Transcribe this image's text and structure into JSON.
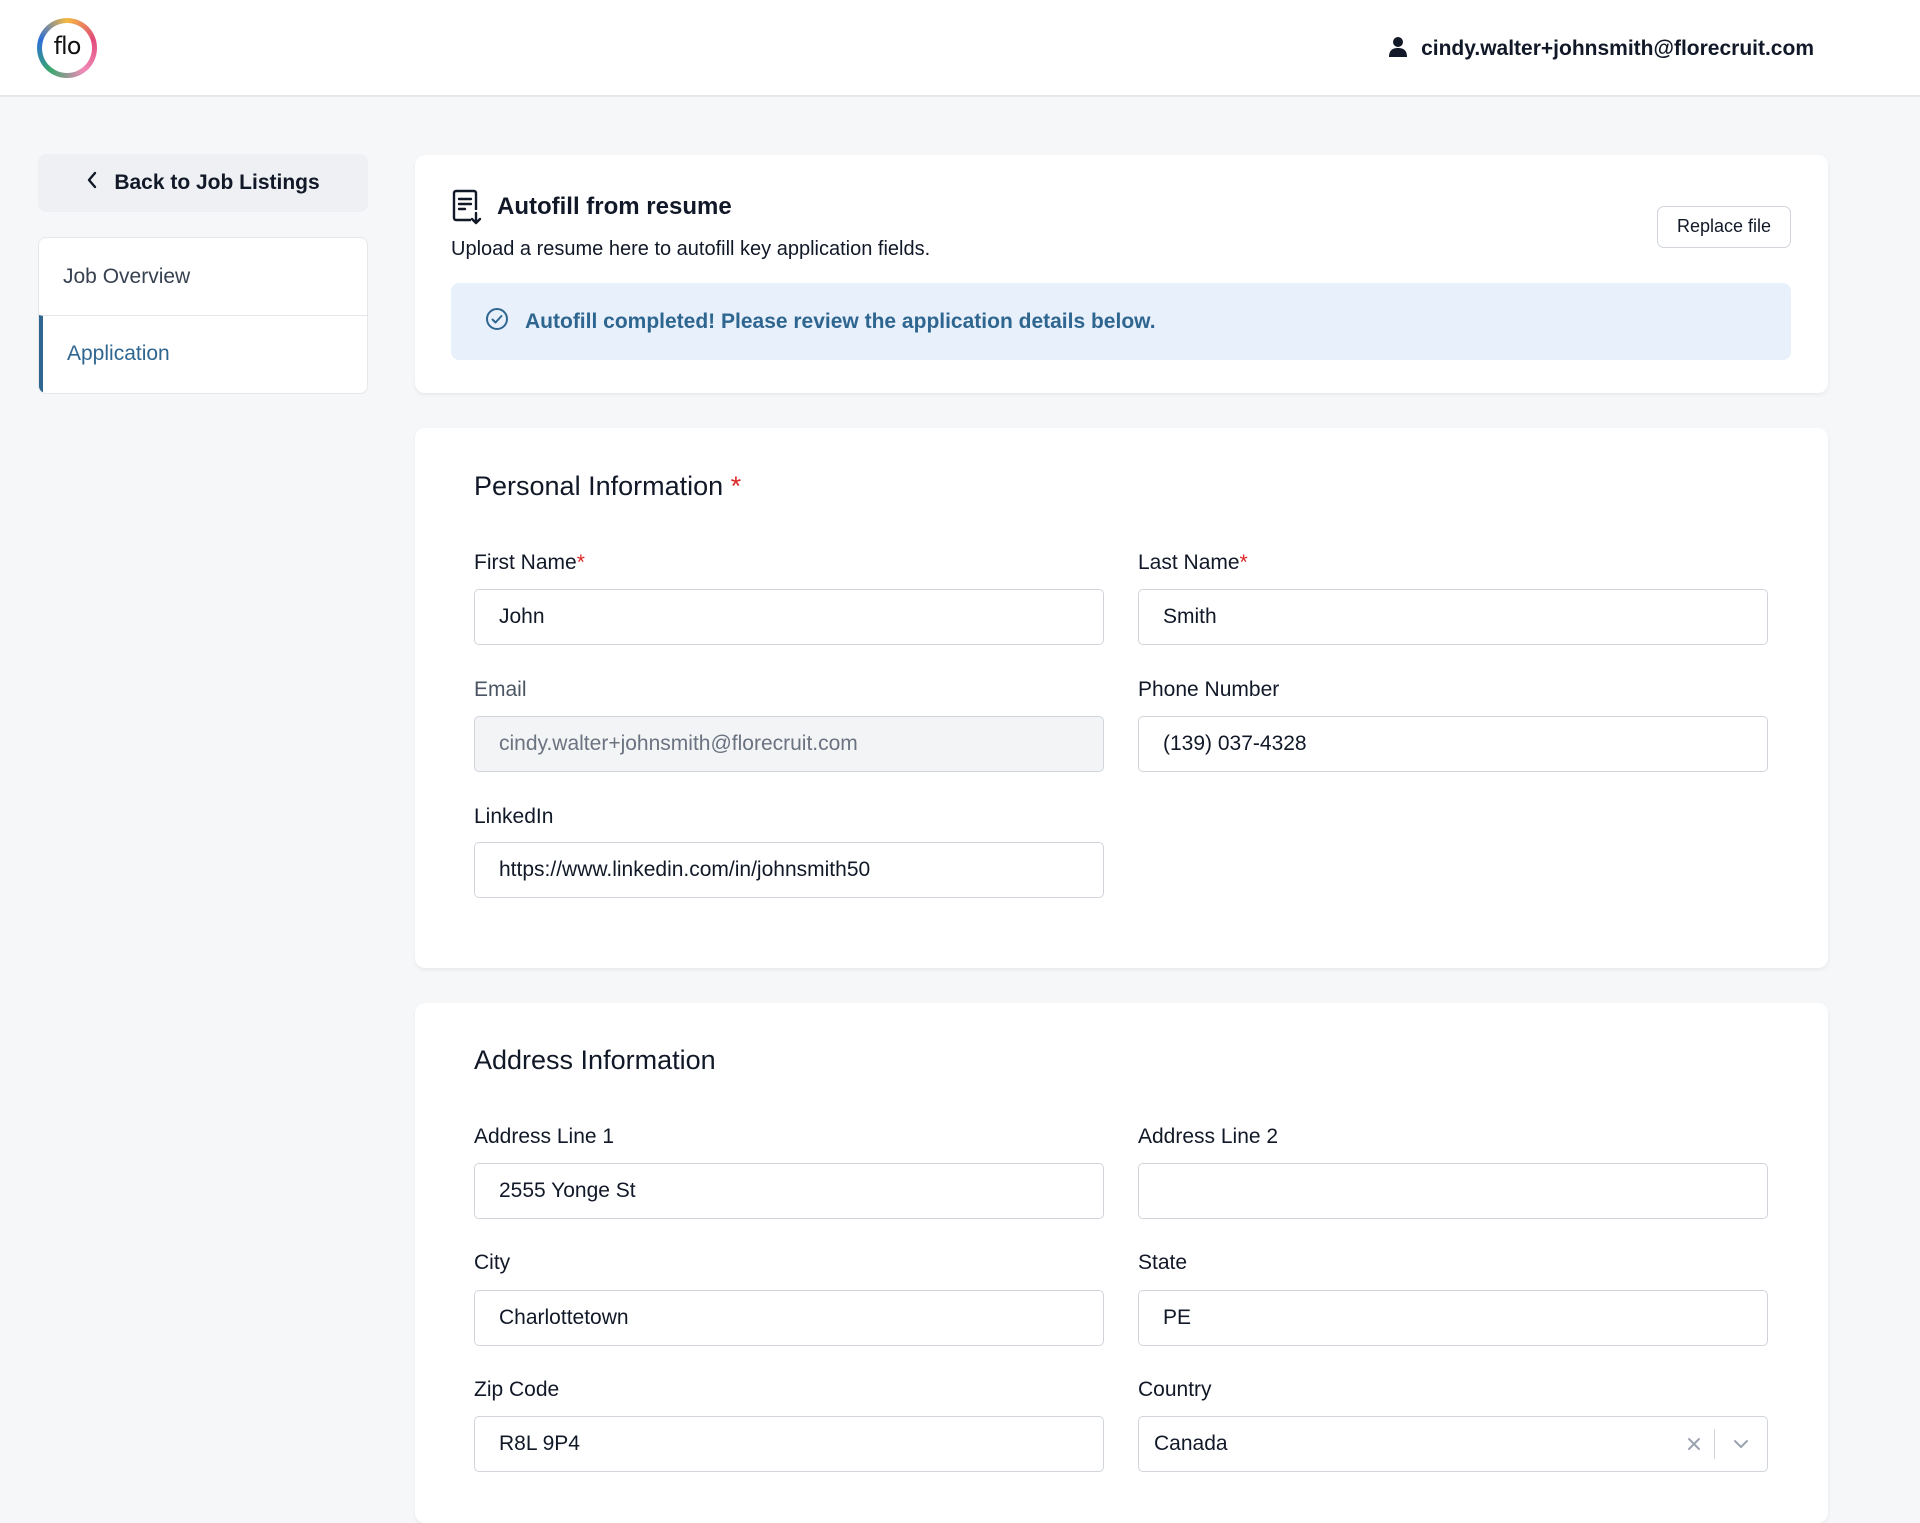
{
  "header": {
    "logo_text": "flo",
    "user_email": "cindy.walter+johnsmith@florecruit.com"
  },
  "sidebar": {
    "back_label": "Back to Job Listings",
    "items": [
      {
        "label": "Job Overview",
        "active": false
      },
      {
        "label": "Application",
        "active": true
      }
    ]
  },
  "autofill": {
    "title": "Autofill from resume",
    "description": "Upload a resume here to autofill key application fields.",
    "replace_label": "Replace file",
    "status_message": "Autofill completed! Please review the application details below."
  },
  "personal": {
    "title": "Personal Information",
    "required_mark": "*",
    "first_name": {
      "label": "First Name",
      "value": "John"
    },
    "last_name": {
      "label": "Last Name",
      "value": "Smith"
    },
    "email": {
      "label": "Email",
      "value": "cindy.walter+johnsmith@florecruit.com"
    },
    "phone": {
      "label": "Phone Number",
      "value": "(139) 037-4328"
    },
    "linkedin": {
      "label": "LinkedIn",
      "value": "https://www.linkedin.com/in/johnsmith50"
    }
  },
  "address": {
    "title": "Address Information",
    "line1": {
      "label": "Address Line 1",
      "value": "2555 Yonge St"
    },
    "line2": {
      "label": "Address Line 2",
      "value": ""
    },
    "city": {
      "label": "City",
      "value": "Charlottetown"
    },
    "state": {
      "label": "State",
      "value": "PE"
    },
    "zip": {
      "label": "Zip Code",
      "value": "R8L 9P4"
    },
    "country": {
      "label": "Country",
      "value": "Canada"
    }
  },
  "colors": {
    "accent": "#2f6690",
    "banner_bg": "#e8f0fb",
    "required": "#dc2626",
    "page_bg": "#f6f7f9"
  }
}
